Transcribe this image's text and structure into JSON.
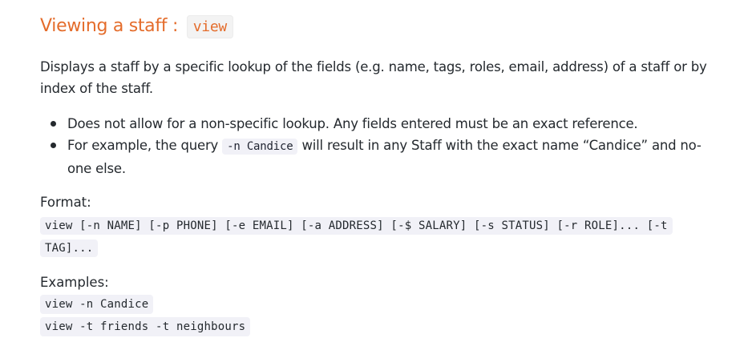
{
  "heading": {
    "text": "Viewing a staff : ",
    "command": "view"
  },
  "description": "Displays a staff by a specific lookup of the fields (e.g. name, tags, roles, email, address) of a staff or by index of the staff.",
  "bullets": [
    {
      "before": "Does not allow for a non-specific lookup. Any fields entered must be an exact reference.",
      "code": "",
      "after": ""
    },
    {
      "before": "For example, the query ",
      "code": "-n Candice",
      "after": " will result in any Staff with the exact name “Candice” and no-one else."
    }
  ],
  "format": {
    "label": "Format:",
    "syntax": "view [-n NAME] [-p PHONE] [-e EMAIL] [-a ADDRESS] [-$ SALARY] [-s STATUS] [-r ROLE]... [-t TAG]..."
  },
  "examples": {
    "label": "Examples:",
    "items": [
      "view -n Candice",
      "view -t friends -t neighbours"
    ]
  }
}
